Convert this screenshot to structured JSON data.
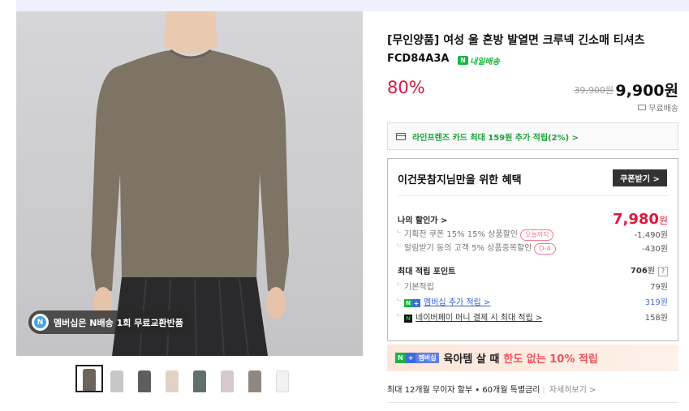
{
  "product": {
    "title": "[무인양품] 여성 울 혼방 발열면 크루넥 긴소매 티셔츠",
    "code": "FCD84A3A",
    "delivery_tag": "내일배송",
    "discount_rate": "80%",
    "original_price": "39,900원",
    "sale_price": "9,900원",
    "shipping": "무료배송"
  },
  "image": {
    "membership_badge": "멤버십은 N배송 1회 무료교환반품",
    "thumbnail_colors": [
      "#6b655c",
      "#c7c7c7",
      "#5d5e5f",
      "#e1d2c6",
      "#61706d",
      "#d5c8cf",
      "#8f8780",
      "#f2f2f2"
    ],
    "main_shirt_color": "#7e7466"
  },
  "card_promo": "라인프렌즈 카드 최대 159원 추가 적립(2%) >",
  "benefit": {
    "heading": "이건못참지님만을 위한 혜택",
    "coupon_button": "쿠폰받기 >",
    "my_discount_label": "나의 할인가 >",
    "my_discount_price": "7,980",
    "my_discount_unit": "원",
    "coupons": [
      {
        "label": "기획전 쿠폰 15% 15% 상품할인",
        "tag": "오늘까지",
        "amount": "-1,490원"
      },
      {
        "label": "알림받기 동의 고객 5% 상품중복할인",
        "tag": "D-4",
        "amount": "-430원"
      }
    ],
    "points_label": "최대 적립 포인트",
    "points_value": "706",
    "points_unit": "원",
    "points_help": "?",
    "basic_label": "기본적립",
    "basic_value": "79원",
    "membership_label": "멤버십 추가 적립 >",
    "membership_value": "319원",
    "npay_label": "네이버페이 머니 결제 시 최대 적립 >",
    "npay_value": "158원"
  },
  "promo_banner": {
    "tag_n": "N",
    "tag_plus": "+",
    "tag_label": "멤버십",
    "text": "육아템 살 때",
    "highlight": "한도 없는 10% 적립"
  },
  "installment": {
    "text": "최대 12개월 무이자 할부 • 60개월 특별금리",
    "more": "자세히보기 >"
  }
}
